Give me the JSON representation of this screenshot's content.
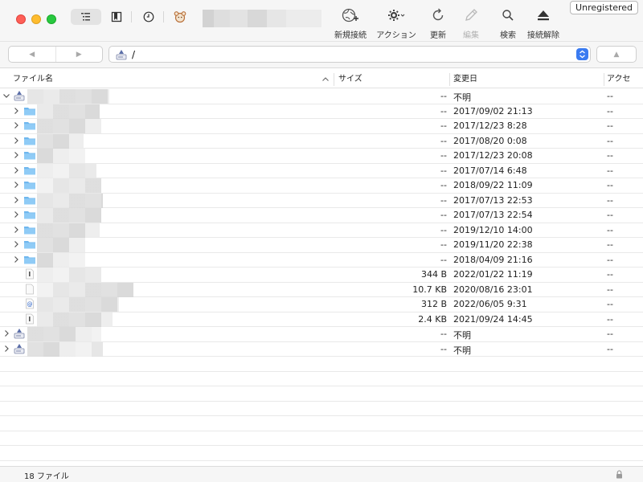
{
  "toolbar": {
    "unregistered_label": "Unregistered",
    "tools": [
      {
        "label": "新規接続",
        "icon": "globe-plus-icon",
        "enabled": true
      },
      {
        "label": "アクション",
        "icon": "gear-icon",
        "enabled": true
      },
      {
        "label": "更新",
        "icon": "refresh-icon",
        "enabled": true
      },
      {
        "label": "編集",
        "icon": "pencil-icon",
        "enabled": false
      },
      {
        "label": "検索",
        "icon": "search-icon",
        "enabled": true
      },
      {
        "label": "接続解除",
        "icon": "eject-icon",
        "enabled": true
      }
    ]
  },
  "pathbar": {
    "path": "/"
  },
  "columns": {
    "name": "ファイル名",
    "size": "サイズ",
    "modified": "変更日",
    "permissions": "アクセ"
  },
  "rows": [
    {
      "kind": "volume",
      "expanded": true,
      "indent": 0,
      "size": "--",
      "date": "不明",
      "perm": "--"
    },
    {
      "kind": "folder",
      "indent": 1,
      "size": "--",
      "date": "2017/09/02 21:13",
      "perm": "--"
    },
    {
      "kind": "folder",
      "indent": 1,
      "size": "--",
      "date": "2017/12/23 8:28",
      "perm": "--"
    },
    {
      "kind": "folder",
      "indent": 1,
      "size": "--",
      "date": "2017/08/20 0:08",
      "perm": "--"
    },
    {
      "kind": "folder",
      "indent": 1,
      "size": "--",
      "date": "2017/12/23 20:08",
      "perm": "--"
    },
    {
      "kind": "folder",
      "indent": 1,
      "size": "--",
      "date": "2017/07/14 6:48",
      "perm": "--"
    },
    {
      "kind": "folder",
      "indent": 1,
      "size": "--",
      "date": "2018/09/22 11:09",
      "perm": "--"
    },
    {
      "kind": "folder",
      "indent": 1,
      "size": "--",
      "date": "2017/07/13 22:53",
      "perm": "--"
    },
    {
      "kind": "folder",
      "indent": 1,
      "size": "--",
      "date": "2017/07/13 22:54",
      "perm": "--"
    },
    {
      "kind": "folder",
      "indent": 1,
      "size": "--",
      "date": "2019/12/10 14:00",
      "perm": "--"
    },
    {
      "kind": "folder",
      "indent": 1,
      "size": "--",
      "date": "2019/11/20 22:38",
      "perm": "--"
    },
    {
      "kind": "folder",
      "indent": 1,
      "size": "--",
      "date": "2018/04/09 21:16",
      "perm": "--"
    },
    {
      "kind": "file-exec",
      "indent": 1,
      "size": "344 B",
      "date": "2022/01/22 11:19",
      "perm": "--"
    },
    {
      "kind": "file",
      "indent": 1,
      "size": "10.7 KB",
      "date": "2020/08/16 23:01",
      "perm": "--"
    },
    {
      "kind": "file-alias",
      "indent": 1,
      "size": "312 B",
      "date": "2022/06/05 9:31",
      "perm": "--"
    },
    {
      "kind": "file-exec",
      "indent": 1,
      "size": "2.4 KB",
      "date": "2021/09/24 14:45",
      "perm": "--"
    },
    {
      "kind": "volume",
      "expanded": false,
      "indent": 0,
      "size": "--",
      "date": "不明",
      "perm": "--"
    },
    {
      "kind": "volume",
      "expanded": false,
      "indent": 0,
      "size": "--",
      "date": "不明",
      "perm": "--"
    }
  ],
  "status": {
    "count": "18 ファイル"
  }
}
